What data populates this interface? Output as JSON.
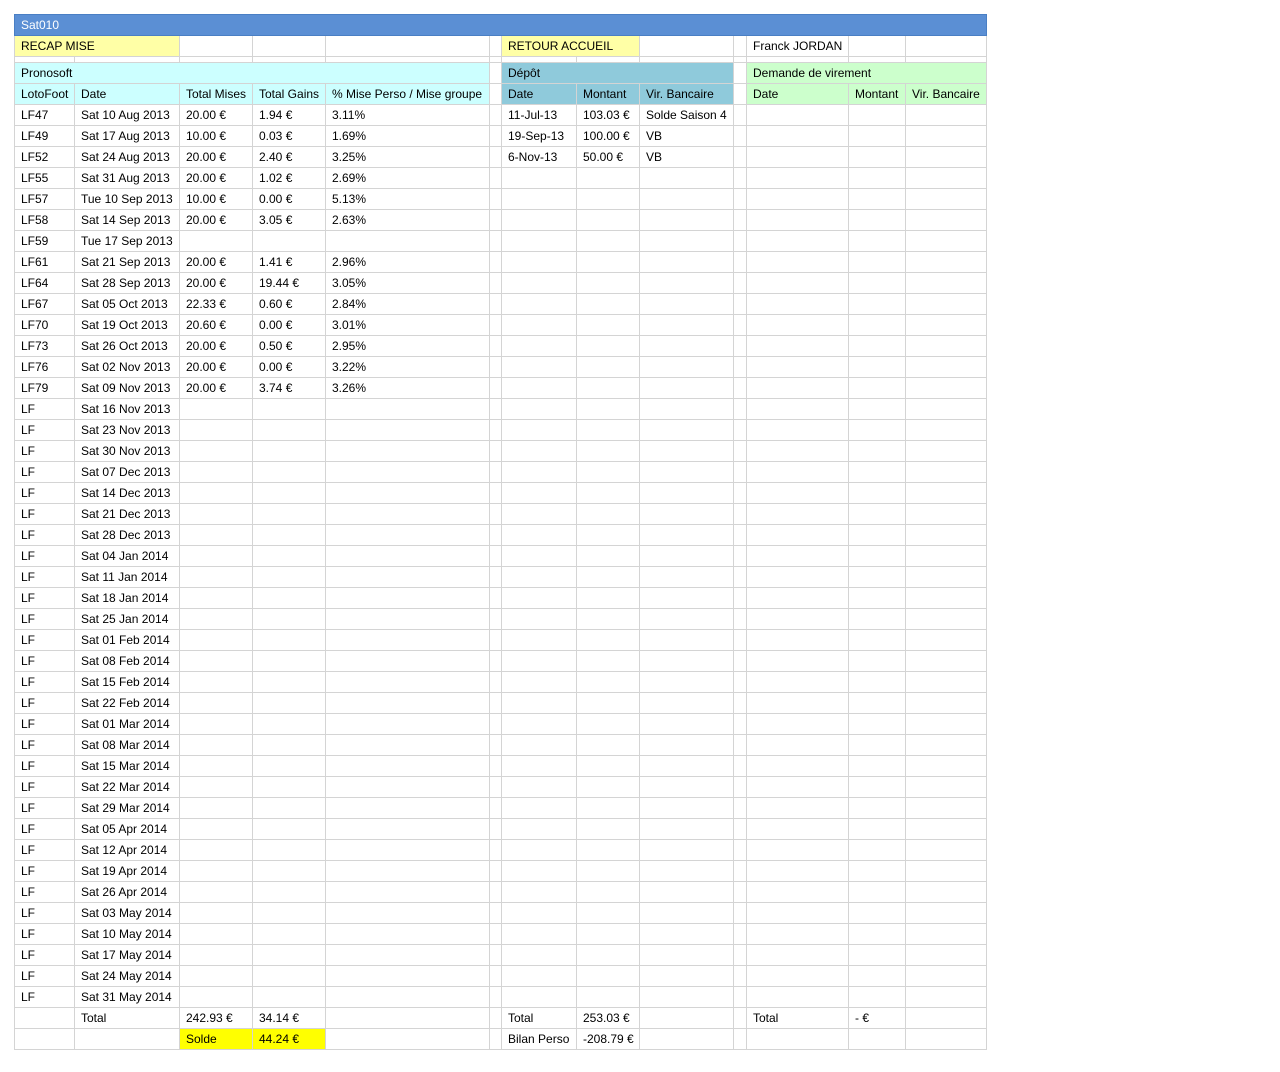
{
  "sheet_name": "Sat010",
  "buttons": {
    "recap": "RECAP MISE",
    "retour": "RETOUR ACCUEIL"
  },
  "player": "Franck JORDAN",
  "pronosoft": {
    "title": "Pronosoft",
    "headers": [
      "LotoFoot",
      "Date",
      "Total Mises",
      "Total Gains",
      "% Mise Perso / Mise groupe"
    ],
    "rows": [
      [
        "LF47",
        "Sat 10 Aug 2013",
        "20.00 €",
        "1.94 €",
        "3.11%"
      ],
      [
        "LF49",
        "Sat 17 Aug 2013",
        "10.00 €",
        "0.03 €",
        "1.69%"
      ],
      [
        "LF52",
        "Sat 24 Aug 2013",
        "20.00 €",
        "2.40 €",
        "3.25%"
      ],
      [
        "LF55",
        "Sat 31 Aug 2013",
        "20.00 €",
        "1.02 €",
        "2.69%"
      ],
      [
        "LF57",
        "Tue 10 Sep 2013",
        "10.00 €",
        "0.00 €",
        "5.13%"
      ],
      [
        "LF58",
        "Sat 14 Sep 2013",
        "20.00 €",
        "3.05 €",
        "2.63%"
      ],
      [
        "LF59",
        "Tue 17 Sep 2013",
        "",
        "",
        ""
      ],
      [
        "LF61",
        "Sat 21 Sep 2013",
        "20.00 €",
        "1.41 €",
        "2.96%"
      ],
      [
        "LF64",
        "Sat 28 Sep 2013",
        "20.00 €",
        "19.44 €",
        "3.05%"
      ],
      [
        "LF67",
        "Sat 05 Oct 2013",
        "22.33 €",
        "0.60 €",
        "2.84%"
      ],
      [
        "LF70",
        "Sat 19 Oct 2013",
        "20.60 €",
        "0.00 €",
        "3.01%"
      ],
      [
        "LF73",
        "Sat 26 Oct 2013",
        "20.00 €",
        "0.50 €",
        "2.95%"
      ],
      [
        "LF76",
        "Sat 02 Nov 2013",
        "20.00 €",
        "0.00 €",
        "3.22%"
      ],
      [
        "LF79",
        "Sat 09 Nov 2013",
        "20.00 €",
        "3.74 €",
        "3.26%"
      ],
      [
        "LF",
        "Sat 16 Nov 2013",
        "",
        "",
        ""
      ],
      [
        "LF",
        "Sat 23 Nov 2013",
        "",
        "",
        ""
      ],
      [
        "LF",
        "Sat 30 Nov 2013",
        "",
        "",
        ""
      ],
      [
        "LF",
        "Sat 07 Dec 2013",
        "",
        "",
        ""
      ],
      [
        "LF",
        "Sat 14 Dec 2013",
        "",
        "",
        ""
      ],
      [
        "LF",
        "Sat 21 Dec 2013",
        "",
        "",
        ""
      ],
      [
        "LF",
        "Sat 28 Dec 2013",
        "",
        "",
        ""
      ],
      [
        "LF",
        "Sat 04 Jan 2014",
        "",
        "",
        ""
      ],
      [
        "LF",
        "Sat 11 Jan 2014",
        "",
        "",
        ""
      ],
      [
        "LF",
        "Sat 18 Jan 2014",
        "",
        "",
        ""
      ],
      [
        "LF",
        "Sat 25 Jan 2014",
        "",
        "",
        ""
      ],
      [
        "LF",
        "Sat 01 Feb 2014",
        "",
        "",
        ""
      ],
      [
        "LF",
        "Sat 08 Feb 2014",
        "",
        "",
        ""
      ],
      [
        "LF",
        "Sat 15 Feb 2014",
        "",
        "",
        ""
      ],
      [
        "LF",
        "Sat 22 Feb 2014",
        "",
        "",
        ""
      ],
      [
        "LF",
        "Sat 01 Mar 2014",
        "",
        "",
        ""
      ],
      [
        "LF",
        "Sat 08 Mar 2014",
        "",
        "",
        ""
      ],
      [
        "LF",
        "Sat 15 Mar 2014",
        "",
        "",
        ""
      ],
      [
        "LF",
        "Sat 22 Mar 2014",
        "",
        "",
        ""
      ],
      [
        "LF",
        "Sat 29 Mar 2014",
        "",
        "",
        ""
      ],
      [
        "LF",
        "Sat 05 Apr 2014",
        "",
        "",
        ""
      ],
      [
        "LF",
        "Sat 12 Apr 2014",
        "",
        "",
        ""
      ],
      [
        "LF",
        "Sat 19 Apr 2014",
        "",
        "",
        ""
      ],
      [
        "LF",
        "Sat 26 Apr 2014",
        "",
        "",
        ""
      ],
      [
        "LF",
        "Sat 03 May 2014",
        "",
        "",
        ""
      ],
      [
        "LF",
        "Sat 10 May 2014",
        "",
        "",
        ""
      ],
      [
        "LF",
        "Sat 17 May 2014",
        "",
        "",
        ""
      ],
      [
        "LF",
        "Sat 24 May 2014",
        "",
        "",
        ""
      ],
      [
        "LF",
        "Sat 31 May 2014",
        "",
        "",
        ""
      ]
    ],
    "total_label": "Total",
    "total_mises": "242.93 €",
    "total_gains": "34.14 €",
    "solde_label": "Solde",
    "solde_value": "44.24 €"
  },
  "depot": {
    "title": "Dépôt",
    "headers": [
      "Date",
      "Montant",
      "Vir. Bancaire"
    ],
    "rows": [
      [
        "11-Jul-13",
        "103.03 €",
        "Solde Saison 4"
      ],
      [
        "19-Sep-13",
        "100.00 €",
        "VB"
      ],
      [
        "6-Nov-13",
        "50.00 €",
        "VB"
      ]
    ],
    "total_label": "Total",
    "total_value": "253.03 €",
    "bilan_label": "Bilan Perso",
    "bilan_value": "-208.79 €"
  },
  "virement": {
    "title": "Demande de virement",
    "headers": [
      "Date",
      "Montant",
      "Vir. Bancaire"
    ],
    "rows": [],
    "total_label": "Total",
    "total_value": "- €"
  },
  "colors": {
    "sheet_bar": "#5b8fd4",
    "button_yellow": "#ffffa6",
    "solde_yellow": "#ffff00",
    "pronosoft_header": "#ccffff",
    "depot_header": "#8fcadb",
    "virement_header": "#ccffcc"
  }
}
